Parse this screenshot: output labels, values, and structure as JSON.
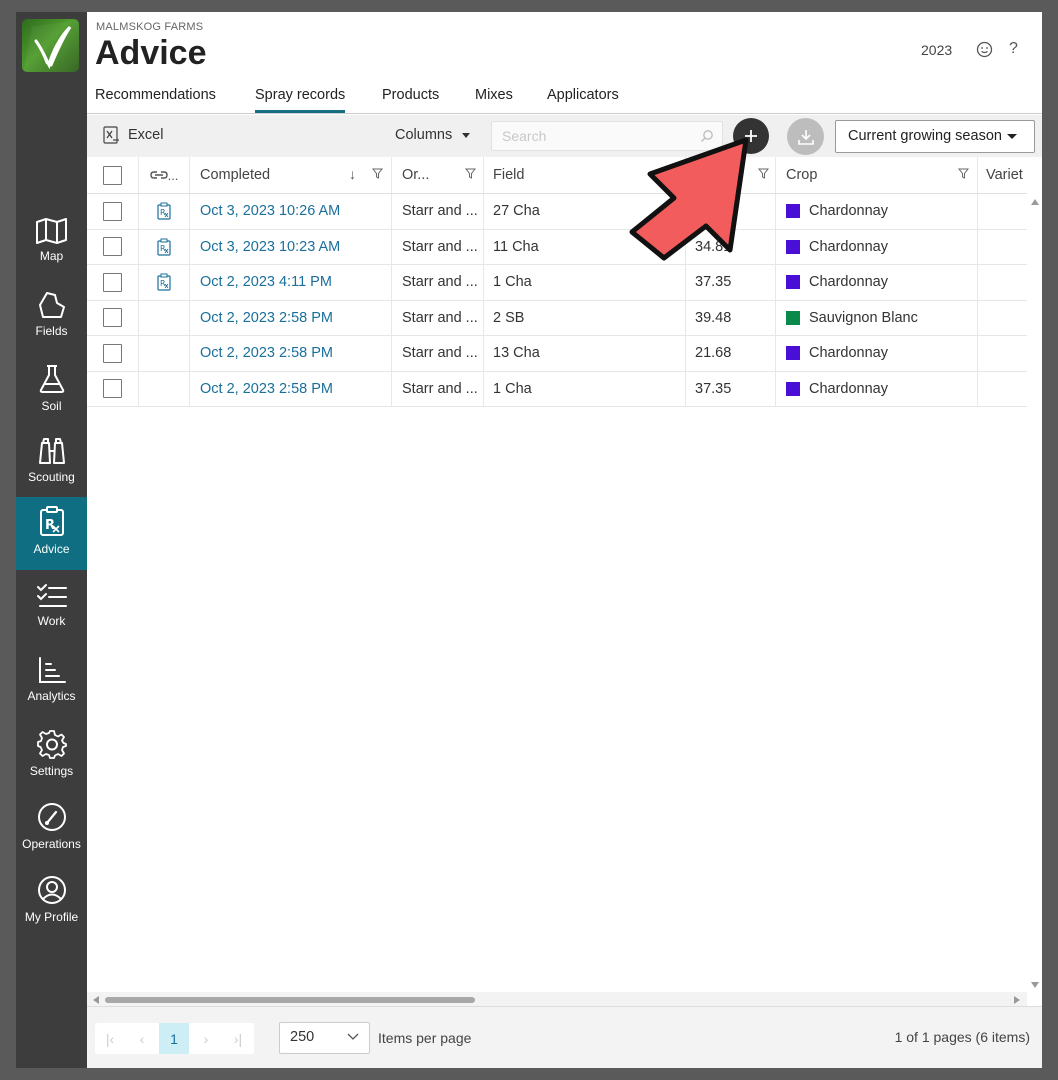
{
  "farm_name": "MALMSKOG FARMS",
  "page_title": "Advice",
  "year": "2023",
  "help_label": "?",
  "tabs": [
    "Recommendations",
    "Spray records",
    "Products",
    "Mixes",
    "Applicators"
  ],
  "active_tab": "Spray records",
  "toolbar": {
    "excel_label": "Excel",
    "columns_label": "Columns",
    "search_placeholder": "Search",
    "season_label": "Current growing season"
  },
  "nav": [
    {
      "label": "Map",
      "icon": "map-icon"
    },
    {
      "label": "Fields",
      "icon": "fields-icon"
    },
    {
      "label": "Soil",
      "icon": "flask-icon"
    },
    {
      "label": "Scouting",
      "icon": "binoculars-icon"
    },
    {
      "label": "Advice",
      "icon": "prescription-icon",
      "active": true
    },
    {
      "label": "Work",
      "icon": "checklist-icon"
    },
    {
      "label": "Analytics",
      "icon": "analytics-icon"
    },
    {
      "label": "Settings",
      "icon": "gear-icon"
    },
    {
      "label": "Operations",
      "icon": "gauge-icon"
    },
    {
      "label": "My Profile",
      "icon": "user-icon"
    }
  ],
  "grid": {
    "headers": {
      "link": "⊘...",
      "completed": "Completed",
      "or": "Or...",
      "field": "Field",
      "crop": "Crop",
      "variety": "Variet"
    },
    "rows": [
      {
        "completed": "Oct 3, 2023 10:26 AM",
        "or": "Starr and ...",
        "field": "27 Cha",
        "area": "",
        "crop": "Chardonnay",
        "crop_color": "#4a0fd6",
        "rx": true
      },
      {
        "completed": "Oct 3, 2023 10:23 AM",
        "or": "Starr and ...",
        "field": "11 Cha",
        "area": "34.81",
        "crop": "Chardonnay",
        "crop_color": "#4a0fd6",
        "rx": true
      },
      {
        "completed": "Oct 2, 2023 4:11 PM",
        "or": "Starr and ...",
        "field": "1 Cha",
        "area": "37.35",
        "crop": "Chardonnay",
        "crop_color": "#4a0fd6",
        "rx": true
      },
      {
        "completed": "Oct 2, 2023 2:58 PM",
        "or": "Starr and ...",
        "field": "2 SB",
        "area": "39.48",
        "crop": "Sauvignon Blanc",
        "crop_color": "#0a8a4a",
        "rx": false
      },
      {
        "completed": "Oct 2, 2023 2:58 PM",
        "or": "Starr and ...",
        "field": "13 Cha",
        "area": "21.68",
        "crop": "Chardonnay",
        "crop_color": "#4a0fd6",
        "rx": false
      },
      {
        "completed": "Oct 2, 2023 2:58 PM",
        "or": "Starr and ...",
        "field": "1 Cha",
        "area": "37.35",
        "crop": "Chardonnay",
        "crop_color": "#4a0fd6",
        "rx": false
      }
    ]
  },
  "footer": {
    "current_page": "1",
    "per_page": "250",
    "items_per_page_label": "Items per page",
    "page_info": "1 of 1 pages (6 items)"
  }
}
